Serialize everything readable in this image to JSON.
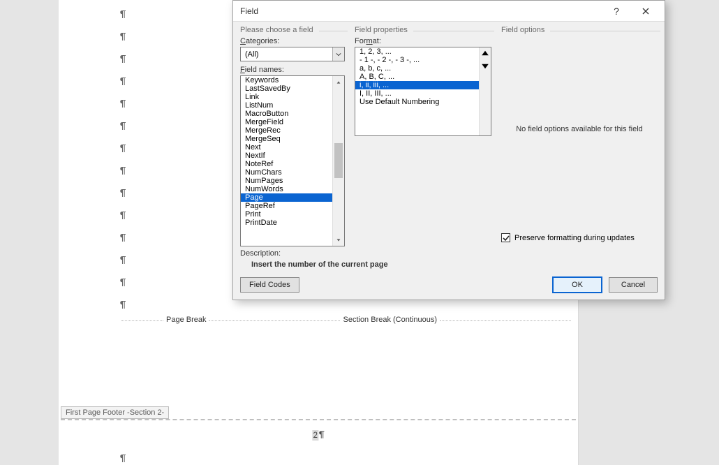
{
  "document": {
    "page_break_label": "Page Break",
    "section_break_label": "Section Break (Continuous)",
    "footer_tag": "First Page Footer -Section 2-",
    "footer_number": "2",
    "pilcrow": "¶"
  },
  "dialog": {
    "title": "Field",
    "help_glyph": "?",
    "left": {
      "header": "Please choose a field",
      "categories_label_pre": "",
      "categories_label_ul": "C",
      "categories_label_post": "ategories:",
      "categories_value": "(All)",
      "field_names_label_pre": "",
      "field_names_label_ul": "F",
      "field_names_label_post": "ield names:",
      "items": [
        "Keywords",
        "LastSavedBy",
        "Link",
        "ListNum",
        "MacroButton",
        "MergeField",
        "MergeRec",
        "MergeSeq",
        "Next",
        "NextIf",
        "NoteRef",
        "NumChars",
        "NumPages",
        "NumWords",
        "Page",
        "PageRef",
        "Print",
        "PrintDate"
      ],
      "selected": "Page"
    },
    "mid": {
      "header": "Field properties",
      "format_label_pre": "For",
      "format_label_ul": "m",
      "format_label_post": "at:",
      "items": [
        "1, 2, 3, ...",
        "- 1 -, - 2 -, - 3 -, ...",
        "a, b, c, ...",
        "A, B, C, ...",
        "i, ii, iii, ...",
        "I, II, III, ...",
        "Use Default Numbering"
      ],
      "selected": "i, ii, iii, ..."
    },
    "right": {
      "header": "Field options",
      "no_options_text": "No field options available for this field",
      "preserve_pre": "Preser",
      "preserve_ul": "v",
      "preserve_post": "e formatting during updates",
      "preserve_checked": true
    },
    "description": {
      "label": "Description:",
      "text": "Insert the number of the current page"
    },
    "buttons": {
      "field_codes_pre": "F",
      "field_codes_ul": "i",
      "field_codes_post": "eld Codes",
      "ok": "OK",
      "cancel": "Cancel"
    }
  }
}
